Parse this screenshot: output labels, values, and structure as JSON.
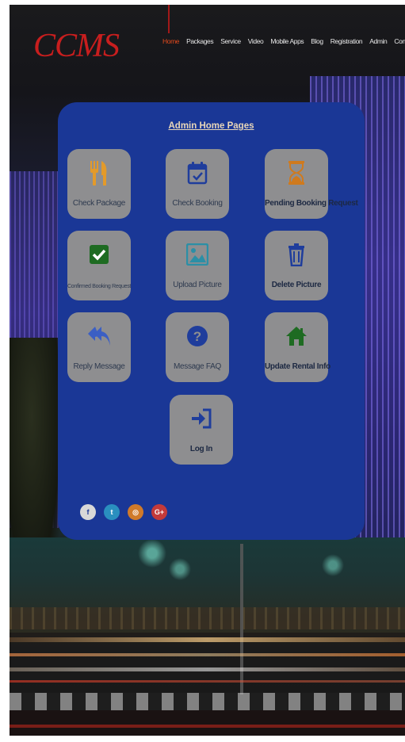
{
  "header": {
    "logo": "CCMS",
    "nav": [
      "Home",
      "Packages",
      "Service",
      "Video",
      "Mobile Apps",
      "Blog",
      "Registration",
      "Admin",
      "Contact"
    ],
    "active": "Home"
  },
  "panel": {
    "title": "Admin Home Pages",
    "tiles": [
      {
        "label": "Check Package",
        "icon": "utensils-icon"
      },
      {
        "label": "Check Booking",
        "icon": "calendar-check-icon"
      },
      {
        "label": "Pending Booking Request",
        "icon": "hourglass-icon"
      },
      {
        "label": "Confirmed Booking Request",
        "icon": "check-square-icon"
      },
      {
        "label": "Upload Picture",
        "icon": "image-icon"
      },
      {
        "label": "Delete Picture",
        "icon": "trash-icon"
      },
      {
        "label": "Reply Message",
        "icon": "reply-all-icon"
      },
      {
        "label": "Message FAQ",
        "icon": "question-circle-icon"
      },
      {
        "label": "Update Rental Info",
        "icon": "home-icon"
      },
      {
        "label": "Log In",
        "icon": "sign-in-icon"
      }
    ],
    "socials": [
      {
        "glyph": "f",
        "icon": "facebook-icon",
        "color": "#d8d8d8"
      },
      {
        "glyph": "t",
        "icon": "twitter-icon",
        "color": "#2a8fbf"
      },
      {
        "glyph": "◎",
        "icon": "instagram-icon",
        "color": "#d07a2a"
      },
      {
        "glyph": "G+",
        "icon": "google-plus-icon",
        "color": "#c43a3a"
      }
    ]
  },
  "colors": {
    "panel": "#1a3796",
    "tile": "#8e8e90",
    "logo": "#c81e1e",
    "nav_active": "#e14a1d"
  }
}
